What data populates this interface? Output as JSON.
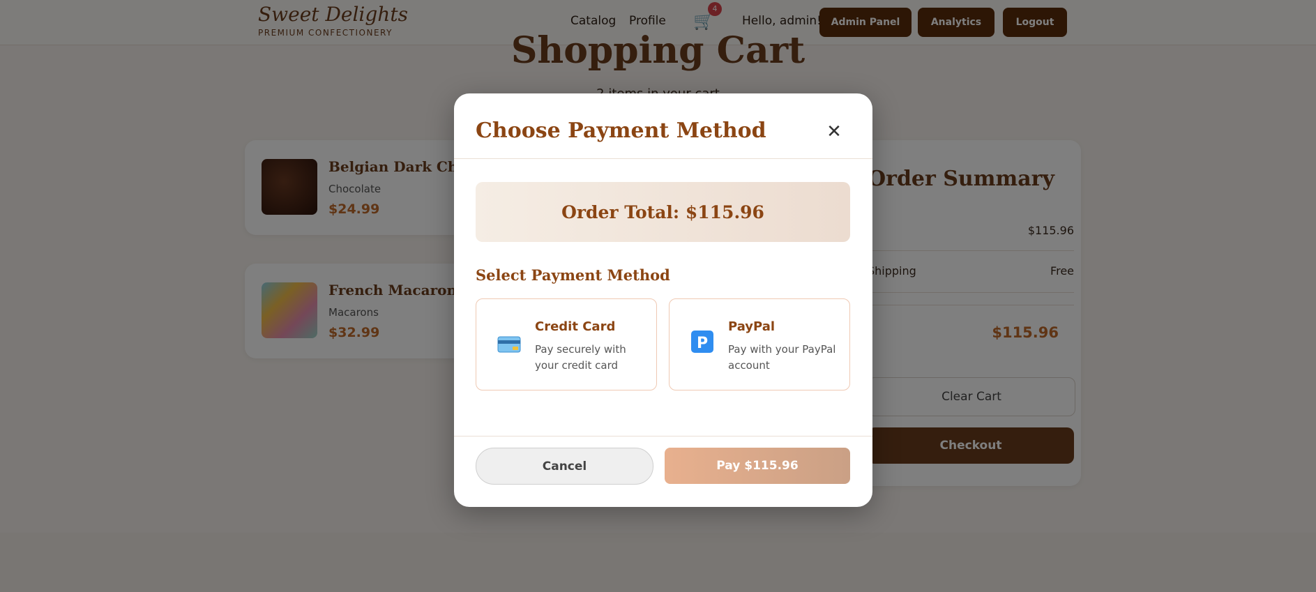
{
  "header": {
    "brand": "Sweet Delights",
    "tagline": "PREMIUM CONFECTIONERY",
    "nav": [
      "Catalog",
      "Profile"
    ],
    "cart_count": "4",
    "greeting": "Hello, admin!",
    "buttons": [
      "Admin Panel",
      "Analytics",
      "Logout"
    ]
  },
  "page": {
    "title": "Shopping Cart",
    "subtitle": "2 items in your cart"
  },
  "cart_items": [
    {
      "name": "Belgian Dark Chocolate",
      "category": "Chocolate",
      "price": "$24.99"
    },
    {
      "name": "French Macarons Assortment",
      "category": "Macarons",
      "price": "$32.99"
    }
  ],
  "summary": {
    "title": "Order Summary",
    "subtotal": "$115.96",
    "shipping_label": "Shipping",
    "shipping": "Free",
    "total": "$115.96",
    "clear_label": "Clear Cart",
    "checkout_label": "Checkout"
  },
  "modal": {
    "title": "Choose Payment Method",
    "order_total": "Order Total: $115.96",
    "select_title": "Select Payment Method",
    "methods": [
      {
        "name": "Credit Card",
        "desc": "Pay securely with your credit card",
        "icon": "credit-card-icon"
      },
      {
        "name": "PayPal",
        "desc": "Pay with your PayPal account",
        "icon": "paypal-icon"
      }
    ],
    "cancel_label": "Cancel",
    "pay_label": "Pay $115.96"
  },
  "colors": {
    "brand": "#6b3d1c",
    "accent": "#c06a2a",
    "modal_title": "#8b4513"
  }
}
